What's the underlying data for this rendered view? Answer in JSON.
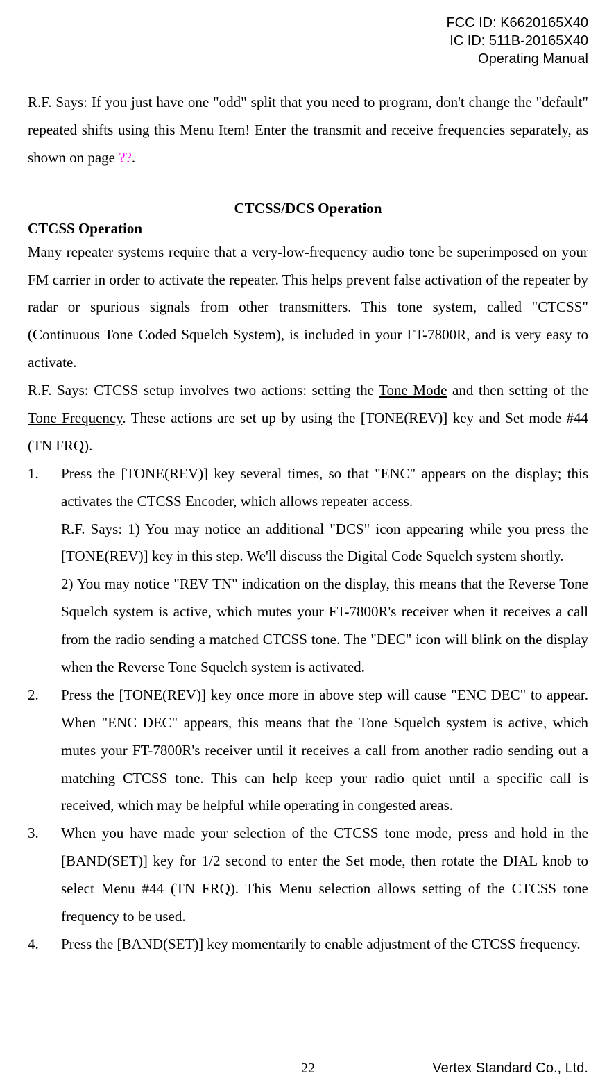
{
  "header": {
    "fcc": "FCC ID: K6620165X40",
    "ic": "IC ID: 511B-20165X40",
    "manual": "Operating Manual"
  },
  "intro": {
    "part1": "R.F. Says: If you just have one \"odd\" split that you need to program, don't change the \"default\" repeated shifts using this Menu Item! Enter the transmit and receive frequencies separately, as shown on page ",
    "qq": "??",
    "part3": "."
  },
  "section_center": "CTCSS/DCS Operation",
  "section_left": "CTCSS Operation",
  "body1": "Many repeater systems require that a very-low-frequency audio tone be superimposed on your FM carrier in order to activate the repeater. This helps prevent false activation of the repeater by radar or spurious signals from other transmitters. This tone system, called \"CTCSS\" (Continuous Tone Coded Squelch System), is included in your FT-7800R, and is very easy to activate.",
  "body2_pre": "R.F. Says: CTCSS setup involves two actions: setting the ",
  "body2_u1": "Tone Mode",
  "body2_mid": " and then setting of the ",
  "body2_u2": "Tone Frequency",
  "body2_post": ". These actions are set up by using the [TONE(REV)] key and Set mode #44 (TN FRQ).",
  "list": {
    "n1": "1.",
    "i1a": "Press the [TONE(REV)] key several times, so that \"ENC\" appears on the display; this activates the CTCSS Encoder, which allows repeater access.",
    "i1b": "R.F. Says: 1) You may notice an additional \"DCS\" icon appearing while you press the [TONE(REV)] key in this step. We'll discuss the Digital Code Squelch system shortly.",
    "i1c": "2) You may notice \"REV TN\" indication on the display, this means that the Reverse Tone Squelch system is active, which mutes your FT-7800R's receiver when it receives a call from the radio sending a matched CTCSS tone. The \"DEC\" icon will blink on the display when the Reverse Tone Squelch system is activated.",
    "n2": "2.",
    "i2": "Press the [TONE(REV)] key once more in above step will cause \"ENC DEC\" to appear. When \"ENC DEC\" appears, this means that the Tone Squelch system is active, which mutes your FT-7800R's receiver until it receives a call from another radio sending out a matching CTCSS tone. This can help keep your radio quiet until a specific call is received, which may be helpful while operating in congested areas.",
    "n3": "3.",
    "i3": "When you have made your selection of the CTCSS tone mode, press and hold in the [BAND(SET)] key for 1/2 second to enter the Set mode, then rotate the DIAL knob to select Menu #44 (TN FRQ). This Menu selection allows setting of the CTCSS tone frequency to be used.",
    "n4": "4.",
    "i4": "Press the [BAND(SET)] key momentarily to enable adjustment of the CTCSS frequency."
  },
  "footer": {
    "page": "22",
    "company": "Vertex Standard Co., Ltd."
  }
}
